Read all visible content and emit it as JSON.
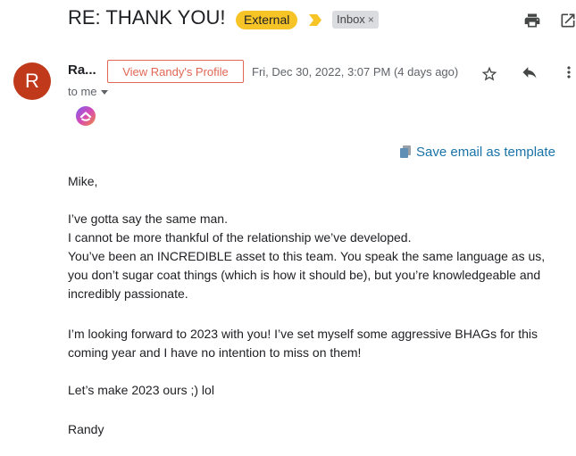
{
  "header": {
    "subject": "RE: THANK YOU!",
    "external_label": "External",
    "inbox_label": "Inbox",
    "inbox_remove": "×"
  },
  "sender": {
    "avatar_letter": "R",
    "avatar_color": "#c0391b",
    "name": "Ra...",
    "profile_button": "View Randy's Profile",
    "date": "Fri, Dec 30, 2022, 3:07 PM (4 days ago)",
    "to_me": "to me"
  },
  "toolbar": {
    "save_template": "Save email as template"
  },
  "icons": [
    "print-icon",
    "open-in-new-window-icon",
    "star-icon",
    "reply-icon",
    "more-vert-icon",
    "importance-arrow-icon",
    "extension-logo-icon",
    "copy-icon"
  ],
  "body": {
    "greeting": "Mike,",
    "p1_l1": "I’ve gotta say the same man.",
    "p1_l2": "I cannot be more thankful of the relationship we’ve developed.",
    "p1_l3": "You’ve been an INCREDIBLE asset to this team.  You speak the same language as us, you don’t sugar coat things (which is how it should be), but you’re knowledgeable and incredibly passionate.",
    "p2": "I’m looking forward to 2023 with you!  I’ve set myself some aggressive BHAGs for this coming year and I have no intention to miss on them!",
    "p3": "Let’s make 2023 ours ;) lol",
    "signoff": "Randy"
  },
  "colors": {
    "external_badge": "#f7c427",
    "profile_button": "#e06754",
    "link_blue": "#1a73a8"
  }
}
